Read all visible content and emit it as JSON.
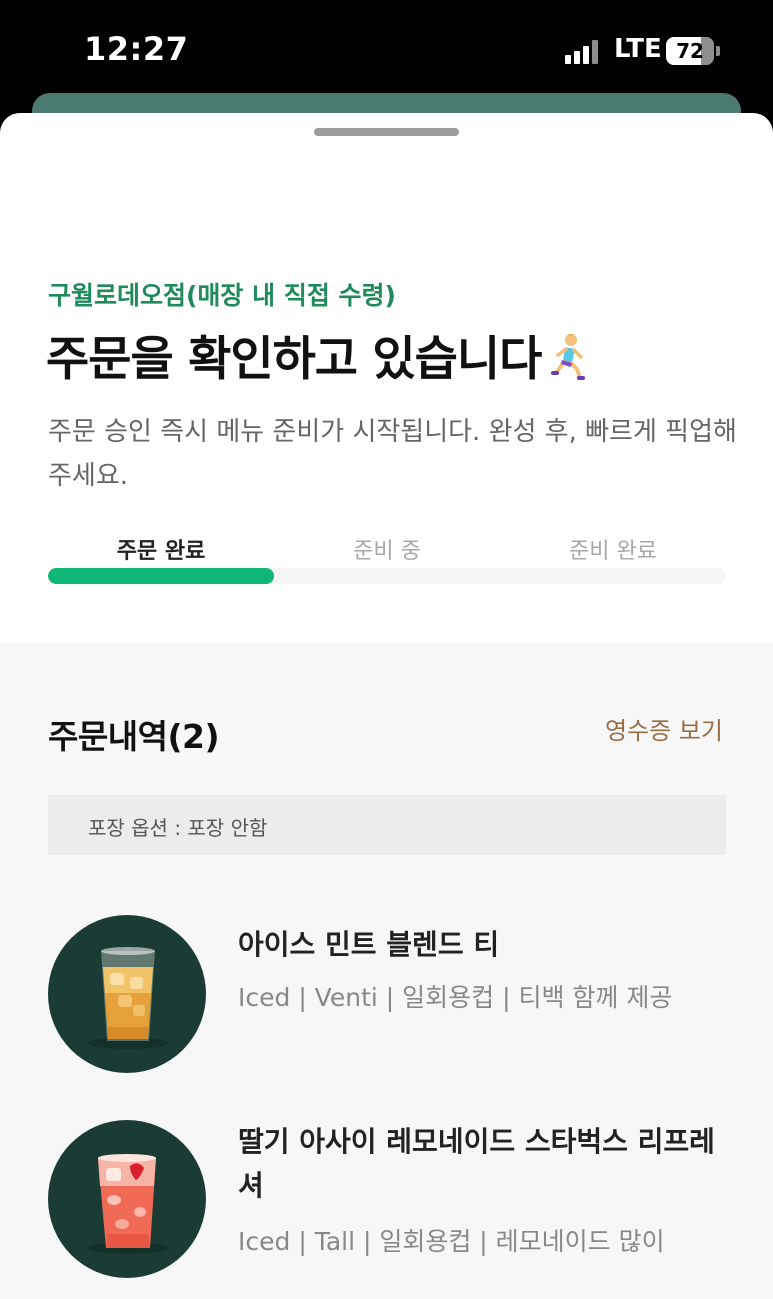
{
  "status_bar": {
    "time": "12:27",
    "network": "LTE",
    "battery": "72",
    "battery_level": 0.72
  },
  "order_status": {
    "store": "구월로데오점(매장 내 직접 수령)",
    "title": "주문을 확인하고 있습니다",
    "title_icon": "woman-running-icon",
    "description": "주문 승인 즉시 메뉴 준비가 시작됩니다. 완성 후, 빠르게 픽업해 주세요.",
    "steps": [
      "주문 완료",
      "준비 중",
      "준비 완료"
    ],
    "active_step": 0,
    "progress": 0.333
  },
  "order_history": {
    "title": "주문내역(2)",
    "receipt_link": "영수증 보기",
    "pack_option": "포장 옵션 : 포장 안함",
    "items": [
      {
        "name": "아이스 민트 블렌드 티",
        "options": "Iced | Venti | 일회용컵 | 티백 함께 제공",
        "image_icon": "iced-tea-icon"
      },
      {
        "name": "딸기 아사이 레모네이드 스타벅스 리프레셔",
        "options": "Iced | Tall | 일회용컵 | 레모네이드 많이",
        "image_icon": "strawberry-refresher-icon"
      }
    ]
  },
  "colors": {
    "brand_green": "#1f8a5b",
    "progress_green": "#10b676",
    "receipt_brown": "#9a6e45",
    "thumb_bg": "#1b3c35"
  }
}
